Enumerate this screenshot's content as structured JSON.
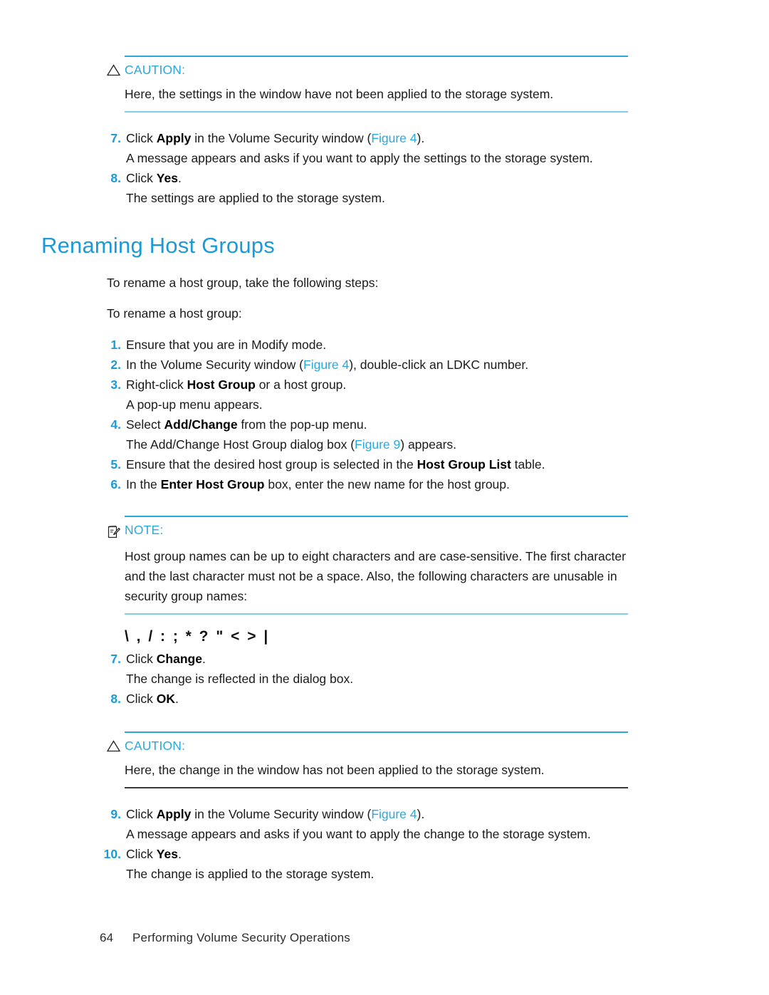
{
  "document": {
    "page_number": "64",
    "footer_title": "Performing Volume Security Operations",
    "accent_color": "#29a8dd",
    "heading_color": "#1b9ad6",
    "body_color": "#1a1a1a"
  },
  "caution_top": {
    "icon": "warning-triangle-icon",
    "title": "CAUTION:",
    "body": "Here, the settings in the window have not been applied to the storage system."
  },
  "steps_top": [
    {
      "num": "7.",
      "text_pre": "Click ",
      "bold1": "Apply",
      "text_mid": " in the Volume Security window (",
      "ref": "Figure 4",
      "text_post": ").",
      "sub": "A message appears and asks if you want to apply the settings to the storage system."
    },
    {
      "num": "8.",
      "text_pre": "Click ",
      "bold1": "Yes",
      "text_mid": "",
      "ref": "",
      "text_post": ".",
      "sub": "The settings are applied to the storage system."
    }
  ],
  "section": {
    "title": "Renaming Host Groups",
    "intro_1": "To rename a host group, take the following steps:",
    "intro_2": "To rename a host group:"
  },
  "steps_main": [
    {
      "num": "1.",
      "text_pre": "Ensure that you are in Modify mode.",
      "bold1": "",
      "text_mid": "",
      "ref": "",
      "text_post": "",
      "sub": ""
    },
    {
      "num": "2.",
      "text_pre": "In the Volume Security window (",
      "bold1": "",
      "text_mid": "",
      "ref": "Figure 4",
      "text_post": "), double-click an LDKC number.",
      "sub": ""
    },
    {
      "num": "3.",
      "text_pre": "Right-click ",
      "bold1": "Host Group",
      "text_mid": " or a host group.",
      "ref": "",
      "text_post": "",
      "sub": "A pop-up menu appears."
    },
    {
      "num": "4.",
      "text_pre": "Select ",
      "bold1": "Add/Change",
      "text_mid": " from the pop-up menu.",
      "ref": "",
      "text_post": "",
      "sub_pre": "The Add/Change Host Group dialog box (",
      "sub_ref": "Figure 9",
      "sub_post": ") appears."
    },
    {
      "num": "5.",
      "text_pre": "Ensure that the desired host group is selected in the ",
      "bold1": "Host Group List",
      "text_mid": " table.",
      "ref": "",
      "text_post": "",
      "sub": ""
    },
    {
      "num": "6.",
      "text_pre": "In the ",
      "bold1": "Enter Host Group",
      "text_mid": " box, enter the new name for the host group.",
      "ref": "",
      "text_post": "",
      "sub": ""
    }
  ],
  "note": {
    "icon": "note-pad-pencil-icon",
    "title": "NOTE:",
    "body": "Host group names can be up to eight characters and are case-sensitive. The first character and the last character must not be a space. Also, the following characters are unusable in security group names:"
  },
  "unusable_characters": "\\ , / : ; * ? \" < > |",
  "steps_after_note": [
    {
      "num": "7.",
      "text_pre": "Click ",
      "bold1": "Change",
      "text_mid": ".",
      "ref": "",
      "text_post": "",
      "sub": "The change is reflected in the dialog box."
    },
    {
      "num": "8.",
      "text_pre": "Click ",
      "bold1": "OK",
      "text_mid": ".",
      "ref": "",
      "text_post": "",
      "sub": ""
    }
  ],
  "caution_bottom": {
    "icon": "warning-triangle-icon",
    "title": "CAUTION:",
    "body": "Here, the change in the window has not been applied to the storage system."
  },
  "steps_end": [
    {
      "num": "9.",
      "text_pre": "Click ",
      "bold1": "Apply",
      "text_mid": " in the Volume Security window (",
      "ref": "Figure 4",
      "text_post": ").",
      "sub": "A message appears and asks if you want to apply the change to the storage system."
    },
    {
      "num": "10.",
      "text_pre": "Click ",
      "bold1": "Yes",
      "text_mid": "",
      "ref": "",
      "text_post": ".",
      "sub": "The change is applied to the storage system."
    }
  ]
}
